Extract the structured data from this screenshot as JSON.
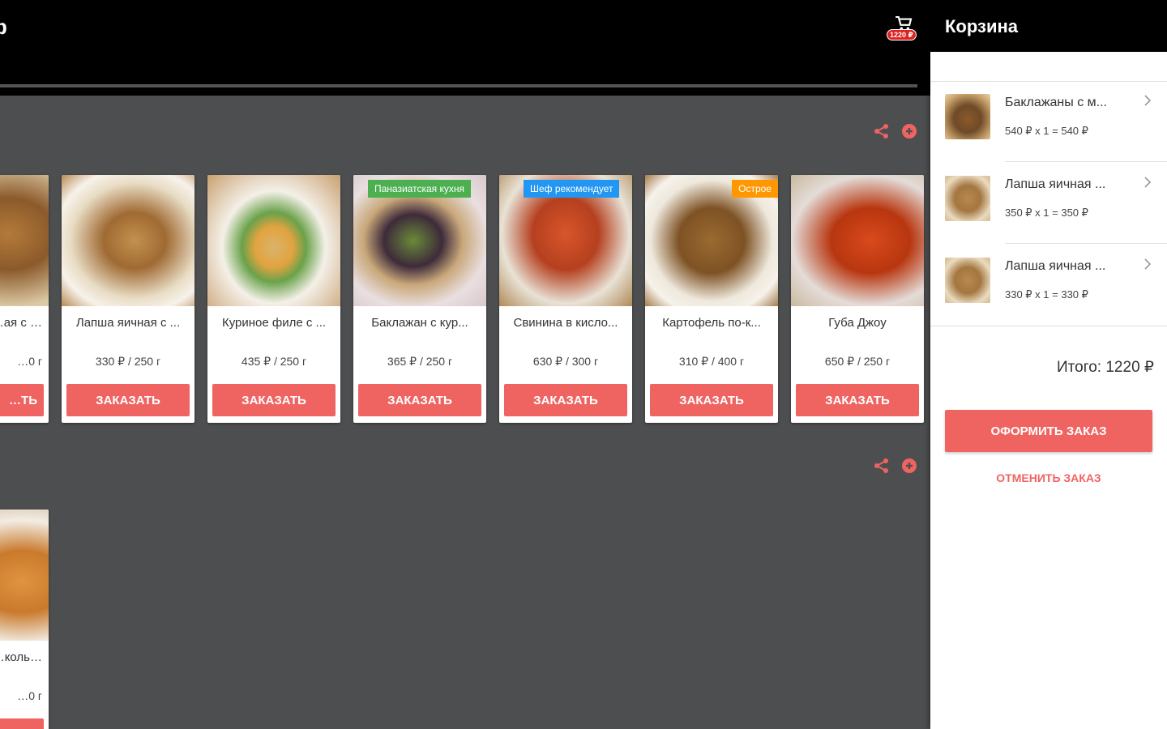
{
  "app": {
    "title_fragment": "ф"
  },
  "header": {
    "cart_total_badge": "1220 ₽"
  },
  "sections": [
    {
      "cards": [
        {
          "name": "…ая с …",
          "price": "…0 г",
          "button": "…ТЬ",
          "tag": "",
          "tag_color": ""
        },
        {
          "name": "Лапша яичная с ...",
          "price": "330 ₽ / 250 г",
          "button": "ЗАКАЗАТЬ",
          "tag": "",
          "tag_color": ""
        },
        {
          "name": "Куриное филе с ...",
          "price": "435 ₽ / 250 г",
          "button": "ЗАКАЗАТЬ",
          "tag": "",
          "tag_color": ""
        },
        {
          "name": "Баклажан с кур...",
          "price": "365 ₽ / 250 г",
          "button": "ЗАКАЗАТЬ",
          "tag": "Паназиатская кухня",
          "tag_color": "#4caf50"
        },
        {
          "name": "Свинина в кисло...",
          "price": "630 ₽ / 300 г",
          "button": "ЗАКАЗАТЬ",
          "tag": "Шеф рекомендует",
          "tag_color": "#2196f3"
        },
        {
          "name": "Картофель по-к...",
          "price": "310 ₽ / 400 г",
          "button": "ЗАКАЗАТЬ",
          "tag": "Острое",
          "tag_color": "#ff9800"
        },
        {
          "name": "Губа Джоу",
          "price": "650 ₽ / 250 г",
          "button": "ЗАКАЗАТЬ",
          "tag": "",
          "tag_color": ""
        }
      ]
    },
    {
      "cards": [
        {
          "name": "…коль…",
          "price": "…0 г",
          "button": "",
          "tag": "",
          "tag_color": ""
        }
      ]
    }
  ],
  "cart": {
    "title": "Корзина",
    "items": [
      {
        "name": "Баклажаны с м...",
        "calc": "540 ₽ x 1 = 540 ₽"
      },
      {
        "name": "Лапша яичная ...",
        "calc": "350 ₽ x 1 = 350 ₽"
      },
      {
        "name": "Лапша яичная ...",
        "calc": "330 ₽ x 1 = 330 ₽"
      }
    ],
    "total": "Итого: 1220 ₽",
    "checkout_label": "ОФОРМИТЬ ЗАКАЗ",
    "cancel_label": "ОТМЕНИТЬ ЗАКАЗ"
  },
  "icons": {
    "share": "share-icon",
    "add": "add-circle-icon",
    "cart": "shopping-cart-icon",
    "chevron": "chevron-right-icon"
  },
  "colors": {
    "accent": "#ef6461",
    "background": "#4d4e50",
    "header": "#000000"
  }
}
